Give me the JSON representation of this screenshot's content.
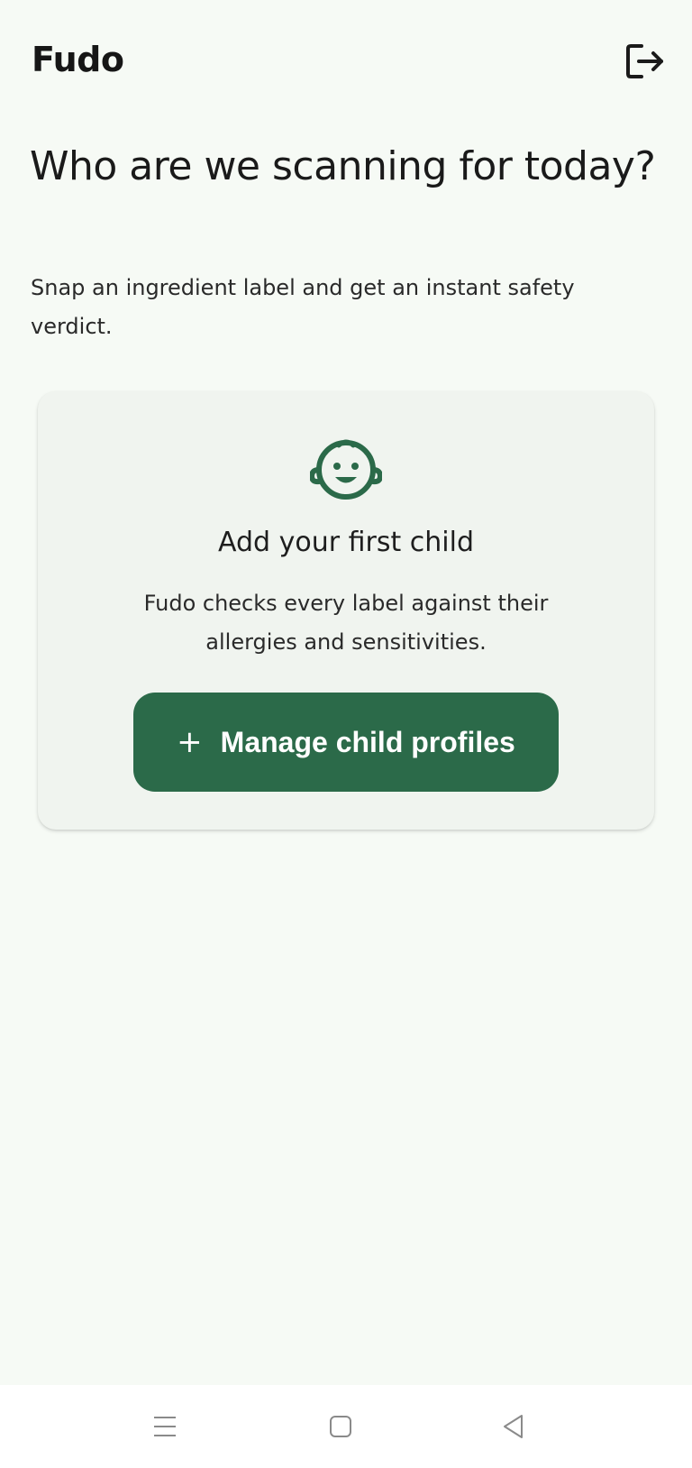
{
  "app": {
    "title": "Fudo",
    "background_color": "#f6faf5",
    "accent_color": "#2b6a49"
  },
  "header": {
    "logout_icon": "logout-icon"
  },
  "main": {
    "heading": "Who are we scanning for today?",
    "subheading": "Snap an ingredient label and get an instant safety verdict."
  },
  "empty_state": {
    "icon": "baby-face-icon",
    "title": "Add your first child",
    "description": "Fudo checks every label against their allergies and sensitivities.",
    "button_icon": "plus-icon",
    "button_label": "Manage child profiles"
  },
  "system_nav": {
    "menu_icon": "menu-icon",
    "home_icon": "home-icon",
    "back_icon": "back-icon"
  }
}
